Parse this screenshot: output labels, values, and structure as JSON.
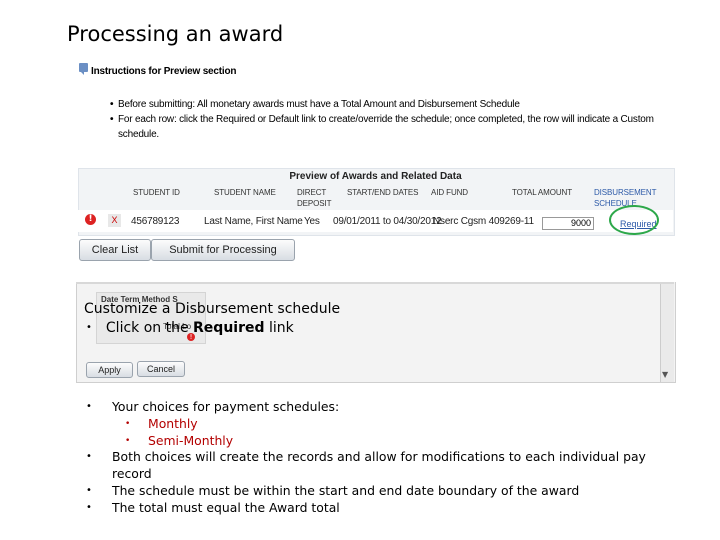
{
  "title": "Processing an award",
  "instructions": {
    "heading": "Instructions for Preview section",
    "items": [
      "Before submitting: All monetary awards must have a Total Amount and Disbursement Schedule",
      "For each row: click the Required or Default link to create/override the schedule; once completed, the row will indicate a Custom schedule."
    ]
  },
  "preview": {
    "title": "Preview of Awards and Related Data",
    "columns": {
      "student_id": "STUDENT ID",
      "student_name": "STUDENT NAME",
      "direct": "DIRECT",
      "deposit": "DEPOSIT",
      "dates": "START/END DATES",
      "aid_fund": "AID FUND",
      "total_amount": "TOTAL AMOUNT",
      "disbursement": "DISBURSEMENT",
      "schedule": "SCHEDULE"
    },
    "row": {
      "error_icon": "!",
      "remove": "X",
      "student_id": "456789123",
      "student_name": "Last Name, First Name",
      "direct_deposit": "Yes",
      "dates": "09/01/2011 to 04/30/2012",
      "aid_fund": "Nserc Cgsm 409269-11",
      "total_amount": "9000",
      "schedule_link": "Required"
    },
    "buttons": {
      "clear": "Clear List",
      "submit": "Submit for Processing"
    }
  },
  "panel": {
    "mini_label": "Date Term Method  S",
    "mini_sub": "Total Lo",
    "apply": "Apply",
    "cancel": "Cancel"
  },
  "overlay": {
    "heading": "Customize a Disbursement schedule",
    "click_prefix": "Click on the ",
    "click_bold": "Required",
    "click_suffix": " link"
  },
  "bullets": {
    "choices": "Your choices for payment schedules:",
    "sub": [
      "Monthly",
      "Semi-Monthly"
    ],
    "both": "Both choices will create the records and allow for modifications to each individual pay record",
    "within": "The schedule must be within the start and end date boundary of the award",
    "total": "The total must equal the Award total"
  },
  "colors": {
    "link": "#2d5aa8",
    "highlight_circle": "#2da84a",
    "error": "#dd2222",
    "sub_bullet": "#b30000"
  }
}
